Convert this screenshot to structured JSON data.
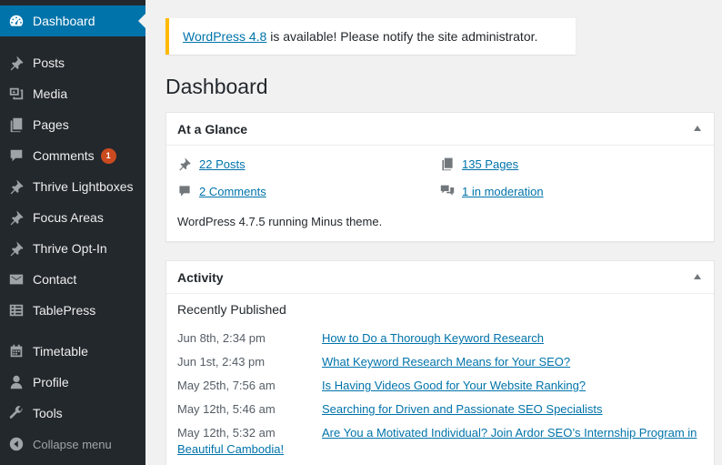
{
  "sidebar": {
    "items": [
      {
        "label": "Dashboard",
        "icon": "dashboard-icon",
        "current": true
      },
      {
        "label": "Posts",
        "icon": "pushpin-icon"
      },
      {
        "label": "Media",
        "icon": "media-icon"
      },
      {
        "label": "Pages",
        "icon": "pages-icon"
      },
      {
        "label": "Comments",
        "icon": "comments-icon",
        "badge": "1"
      },
      {
        "label": "Thrive Lightboxes",
        "icon": "pushpin-icon"
      },
      {
        "label": "Focus Areas",
        "icon": "pushpin-icon"
      },
      {
        "label": "Thrive Opt-In",
        "icon": "pushpin-icon"
      },
      {
        "label": "Contact",
        "icon": "mail-icon"
      },
      {
        "label": "TablePress",
        "icon": "table-icon"
      },
      {
        "label": "Timetable",
        "icon": "calendar-icon"
      },
      {
        "label": "Profile",
        "icon": "user-icon"
      },
      {
        "label": "Tools",
        "icon": "wrench-icon"
      }
    ],
    "collapse_label": "Collapse menu"
  },
  "notice": {
    "link_text": "WordPress 4.8",
    "text": " is available! Please notify the site administrator."
  },
  "page_title": "Dashboard",
  "at_a_glance": {
    "title": "At a Glance",
    "posts": "22 Posts",
    "pages": "135 Pages",
    "comments": "2 Comments",
    "moderation": "1 in moderation",
    "footer": "WordPress 4.7.5 running Minus theme."
  },
  "activity": {
    "title": "Activity",
    "subtitle": "Recently Published",
    "rows": [
      {
        "date": "Jun 8th, 2:34 pm",
        "title": "How to Do a Thorough Keyword Research"
      },
      {
        "date": "Jun 1st, 2:43 pm",
        "title": "What Keyword Research Means for Your SEO?"
      },
      {
        "date": "May 25th, 7:56 am",
        "title": "Is Having Videos Good for Your Website Ranking?"
      },
      {
        "date": "May 12th, 5:46 am",
        "title": "Searching for Driven and Passionate SEO Specialists"
      },
      {
        "date": "May 12th, 5:32 am",
        "title": "Are You a Motivated Individual? Join Ardor SEO’s Internship Program in Beautiful Cambodia!"
      }
    ]
  },
  "colors": {
    "sidebar_bg": "#23282d",
    "accent": "#0073aa",
    "notice_border": "#ffb900",
    "badge": "#ca4a1f"
  }
}
